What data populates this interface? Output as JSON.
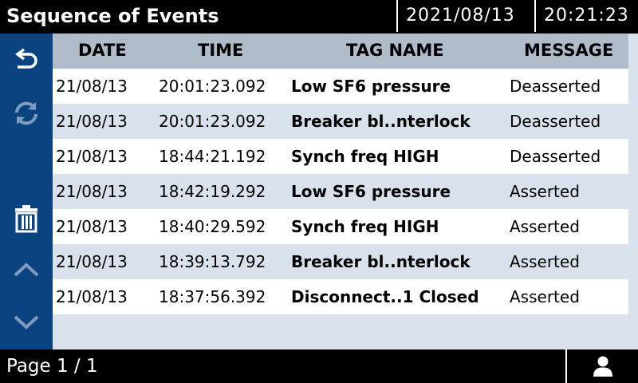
{
  "header": {
    "title": "Sequence of Events",
    "date": "2021/08/13",
    "time": "20:21:23"
  },
  "sidebar": {
    "icons": [
      "back-icon",
      "refresh-icon",
      "trash-icon",
      "chevron-up-icon",
      "chevron-down-icon"
    ]
  },
  "table": {
    "headers": {
      "date": "DATE",
      "time": "TIME",
      "tag": "TAG NAME",
      "message": "MESSAGE"
    },
    "rows": [
      {
        "date": "21/08/13",
        "time": "20:01:23.092",
        "tag": "Low SF6 pressure",
        "message": "Deasserted"
      },
      {
        "date": "21/08/13",
        "time": "20:01:23.092",
        "tag": "Breaker bl..nterlock",
        "message": "Deasserted"
      },
      {
        "date": "21/08/13",
        "time": "18:44:21.192",
        "tag": "Synch freq HIGH",
        "message": "Deasserted"
      },
      {
        "date": "21/08/13",
        "time": "18:42:19.292",
        "tag": "Low SF6 pressure",
        "message": "Asserted"
      },
      {
        "date": "21/08/13",
        "time": "18:40:29.592",
        "tag": "Synch freq HIGH",
        "message": "Asserted"
      },
      {
        "date": "21/08/13",
        "time": "18:39:13.792",
        "tag": "Breaker bl..nterlock",
        "message": "Asserted"
      },
      {
        "date": "21/08/13",
        "time": "18:37:56.392",
        "tag": "Disconnect..1 Closed",
        "message": "Asserted"
      }
    ]
  },
  "footer": {
    "page_label": "Page 1 / 1",
    "user_icon": "user-icon"
  },
  "colors": {
    "sidebar": "#0a4380",
    "header_row": "#b1bccb",
    "row_alt": "#d9e2ec",
    "row": "#ffffff",
    "disabled_icon": "#7f9cc0"
  }
}
